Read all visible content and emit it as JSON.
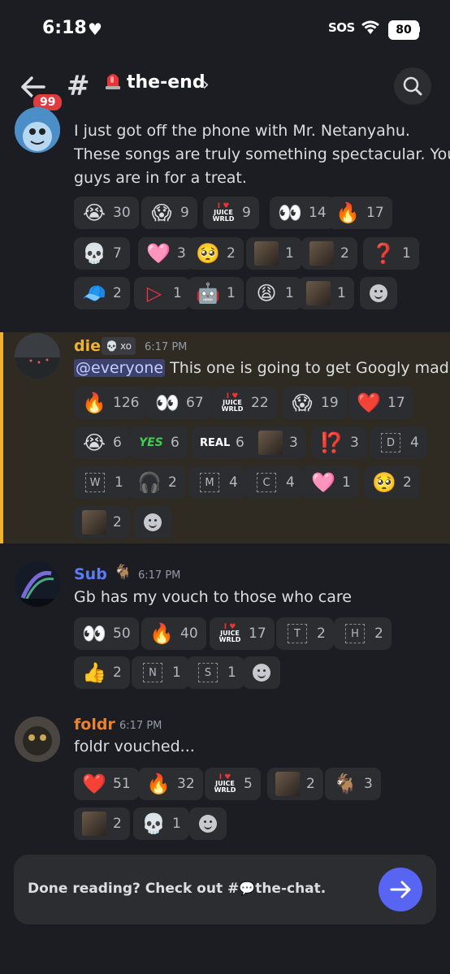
{
  "status": {
    "time": "6:18",
    "sos": "SOS",
    "battery": "80"
  },
  "header": {
    "badge": "99",
    "channel": "the-end"
  },
  "messages": [
    {
      "text": "I just got off the phone with Mr. Netanyahu.\nThese songs are truly something spectacular. You\nguys are in for a treat.",
      "reactions": [
        {
          "emoji": "😭",
          "count": "30"
        },
        {
          "emoji": "😱",
          "count": "9"
        },
        {
          "emoji": "juice",
          "count": "9"
        },
        {
          "emoji": "👀",
          "count": "14"
        },
        {
          "emoji": "🔥",
          "count": "17"
        },
        {
          "emoji": "💀",
          "count": "7"
        },
        {
          "emoji": "🩷",
          "count": "3"
        },
        {
          "emoji": "🥺",
          "count": "2"
        },
        {
          "emoji": "photo",
          "count": "1"
        },
        {
          "emoji": "photo",
          "count": "2"
        },
        {
          "emoji": "❓",
          "count": "1"
        },
        {
          "emoji": "🧢",
          "count": "2"
        },
        {
          "emoji": "▷",
          "count": "1"
        },
        {
          "emoji": "🤖",
          "count": "1"
        },
        {
          "emoji": "😩",
          "count": "1"
        },
        {
          "emoji": "photo",
          "count": "1"
        }
      ]
    },
    {
      "username": "die",
      "tag": "xo",
      "timestamp": "6:17 PM",
      "mention": "@everyone",
      "text": "This one is going to get Googly mad...",
      "reactions": [
        {
          "emoji": "🔥",
          "count": "126"
        },
        {
          "emoji": "👀",
          "count": "67"
        },
        {
          "emoji": "juice",
          "count": "22"
        },
        {
          "emoji": "😱",
          "count": "19"
        },
        {
          "emoji": "❤️",
          "count": "17"
        },
        {
          "emoji": "😭",
          "count": "6"
        },
        {
          "emoji": "YES",
          "count": "6"
        },
        {
          "emoji": "REAL",
          "count": "6"
        },
        {
          "emoji": "photo",
          "count": "3"
        },
        {
          "emoji": "⁉️",
          "count": "3"
        },
        {
          "emoji": "D",
          "count": "4"
        },
        {
          "emoji": "W",
          "count": "1"
        },
        {
          "emoji": "🎧",
          "count": "2"
        },
        {
          "emoji": "M",
          "count": "4"
        },
        {
          "emoji": "C",
          "count": "4"
        },
        {
          "emoji": "🩷",
          "count": "1"
        },
        {
          "emoji": "🥺",
          "count": "2"
        },
        {
          "emoji": "photo",
          "count": "2"
        }
      ]
    },
    {
      "username": "Sub",
      "timestamp": "6:17 PM",
      "text": "Gb has my vouch to those who care",
      "reactions": [
        {
          "emoji": "👀",
          "count": "50"
        },
        {
          "emoji": "🔥",
          "count": "40"
        },
        {
          "emoji": "juice",
          "count": "17"
        },
        {
          "emoji": "T",
          "count": "2"
        },
        {
          "emoji": "H",
          "count": "2"
        },
        {
          "emoji": "👍",
          "count": "2"
        },
        {
          "emoji": "N",
          "count": "1"
        },
        {
          "emoji": "S",
          "count": "1"
        }
      ]
    },
    {
      "username": "foldr",
      "timestamp": "6:17 PM",
      "text": "foldr vouched...",
      "reactions": [
        {
          "emoji": "❤️",
          "count": "51"
        },
        {
          "emoji": "🔥",
          "count": "32"
        },
        {
          "emoji": "juice",
          "count": "5"
        },
        {
          "emoji": "photo",
          "count": "2"
        },
        {
          "emoji": "🐐",
          "count": "3"
        },
        {
          "emoji": "photo",
          "count": "2"
        },
        {
          "emoji": "💀",
          "count": "1"
        }
      ]
    }
  ],
  "juice_label": {
    "line1": "JUICE",
    "line2": "WRLD"
  },
  "bottom": {
    "prefix": "Done reading? Check out #",
    "channel": "the-chat."
  },
  "colors": {
    "accent": "#5865f2",
    "highlight": "#f0b232",
    "die": "#f0b232",
    "sub": "#5b7cf5",
    "foldr": "#e8822e"
  }
}
